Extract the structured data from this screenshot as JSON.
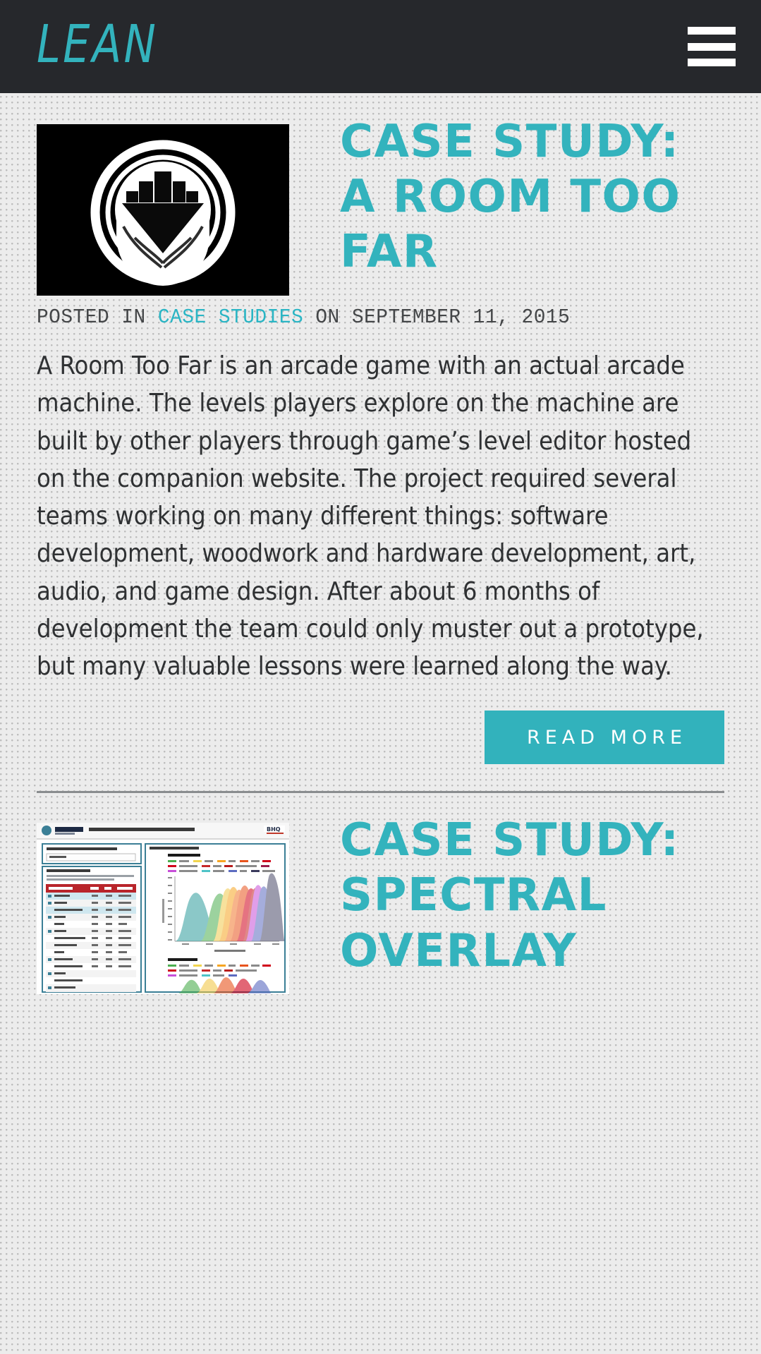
{
  "theme": {
    "accent": "#32b2bc",
    "header_bg": "#26282c",
    "page_bg": "#ececec",
    "body_text": "#2f3133",
    "meta_text": "#444648",
    "divider": "#8a8d8f"
  },
  "header": {
    "brand": "LEAN",
    "menu_icon": "hamburger-menu-icon",
    "menu_label": "Menu"
  },
  "posts": [
    {
      "title": "Case Study: A Room Too Far",
      "thumbnail_alt": "a-room-too-far-logo",
      "meta": {
        "posted_in_label": "Posted in",
        "category": "Case Studies",
        "on_label": "on",
        "date": "September 11, 2015"
      },
      "excerpt": "A Room Too Far is an arcade game with an actual arcade machine. The levels players explore on the machine are built by other players through game’s level editor hosted on the companion website. The project required several teams working on many different things: software development, woodwork and hardware development, art, audio, and game design. After about 6 months of development the team could only muster out a prototype, but many valuable lessons were learned along the way.",
      "read_more_label": "Read More"
    },
    {
      "title": "Case Study: Spectral Overlay",
      "thumbnail_alt": "spectral-overlay-tool-screenshot",
      "thumbnail_caption": {
        "brand": "BIOSEARCH",
        "brand_sub": "TECHNOLOGIES",
        "badge": "BHQ",
        "header_title": "SPECTRAL OVERLAY TOOL FOR MULTIPLEXED QPCR",
        "panel_instrument_label": "SELECT YOUR REAL-TIME PCR INSTRUMENT",
        "panel_instrument_value": "CFX96™",
        "panel_dyes_label": "SELECT YOUR DYES",
        "panel_dyes_note": "Recommended dyes are highlighted in blue. Dyes in boldface are available from Biosearch Technologies.",
        "charts_label": "SPECTRAL OVERLAY CHARTS",
        "chart1_title": "Absorption Spectra",
        "chart2_title": "Emission Spectra",
        "y_axis": "Normalized Absorbance",
        "x_axis": "Wavelength (nm)",
        "table_headers": [
          "Fluorophore",
          "ABS",
          "EM",
          "Quencher"
        ],
        "table_rows": [
          [
            "FAM",
            "495",
            "520",
            "BHQ-1"
          ],
          [
            "TET",
            "521",
            "536",
            "BHQ-1"
          ],
          [
            "CAL Fluor® Gold 540",
            "522",
            "544",
            "BHQ-1"
          ],
          [
            "JOE",
            "529",
            "555",
            "BHQ-1"
          ],
          [
            "HEX",
            "535",
            "556",
            "N/A"
          ],
          [
            "VIC",
            "538",
            "554",
            "BHQ-1"
          ],
          [
            "CAL Fluor Orange 560",
            "538",
            "559",
            "BHQ-1"
          ],
          [
            "Quasar® 570",
            "548",
            "566",
            "BHQ-2"
          ],
          [
            "Cy® 3",
            "546",
            "566",
            "N/A"
          ],
          [
            "TAMRA",
            "557",
            "583",
            "BHQ-2"
          ],
          [
            "CAL Fluor Red 590",
            "569",
            "591",
            "BHQ-2"
          ],
          [
            "ROX",
            "575",
            "602",
            "BHQ-2"
          ],
          [
            "CAL Fluor Red 610",
            "590",
            "610",
            "BHQ-2"
          ],
          [
            "Texas Red®",
            "597",
            "616",
            "BHQ-2"
          ],
          [
            "CAL Fluor Red 635",
            "618",
            "637",
            "BHQ-2"
          ],
          [
            "LC Red 640",
            "617",
            "643",
            "BHQ-2"
          ]
        ],
        "legend_absorption": [
          "FAM",
          "TET",
          "JOE",
          "HEX",
          "Quasar 570",
          "TAMRA",
          "CAL Fluor Red 590",
          "ROX",
          "CAL Fluor Red 610",
          "CAL Fluor Red 635",
          "Pulsar 650",
          "Cy 5",
          "Quasar 705"
        ]
      }
    }
  ]
}
